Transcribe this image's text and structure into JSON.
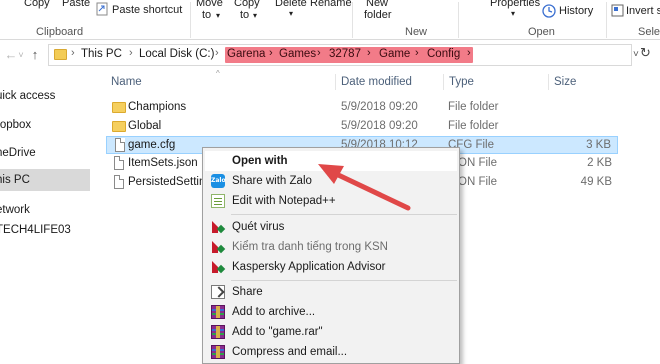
{
  "ribbon": {
    "copy_label": "Copy",
    "paste_label": "Paste",
    "paste_shortcut_label": "Paste shortcut",
    "move_to_label": "Move",
    "move_to_label2": "to",
    "copy_to_label": "Copy",
    "copy_to_label2": "to",
    "delete_label": "Delete",
    "rename_label": "Rename",
    "new_folder_label": "New",
    "new_folder_label2": "folder",
    "properties_label": "Properties",
    "history_label": "History",
    "invert_label": "Invert s",
    "groups": {
      "clipboard": "Clipboard",
      "new": "New",
      "open": "Open",
      "select": "Selec"
    }
  },
  "address": {
    "crumbs": [
      "This PC",
      "Local Disk (C:)",
      "Garena",
      "Games",
      "32787",
      "Game",
      "Config"
    ],
    "highlight_color": "#f27b88"
  },
  "navpane": {
    "items": [
      "uick access",
      "ropbox",
      "neDrive",
      "his PC",
      "etwork",
      "TECH4LIFE03"
    ],
    "selected": "his PC"
  },
  "list": {
    "headers": {
      "name": "Name",
      "date": "Date modified",
      "type": "Type",
      "size": "Size"
    },
    "rows": [
      {
        "icon": "folder-icon",
        "name": "Champions",
        "date": "5/9/2018 09:20",
        "type": "File folder",
        "size": ""
      },
      {
        "icon": "folder-icon",
        "name": "Global",
        "date": "5/9/2018 09:20",
        "type": "File folder",
        "size": ""
      },
      {
        "icon": "file-icon",
        "name": "game.cfg",
        "date": "5/9/2018 10:12",
        "type": "CFG File",
        "size": "3 KB"
      },
      {
        "icon": "file-icon",
        "name": "ItemSets.json",
        "date": "",
        "type": "ON File",
        "size": "2 KB"
      },
      {
        "icon": "file-icon",
        "name": "PersistedSetting",
        "date": "",
        "type": "ON File",
        "size": "49 KB"
      }
    ],
    "selected_row": "game.cfg"
  },
  "context_menu": {
    "items": [
      {
        "label": "Open with",
        "icon": "",
        "bold": true
      },
      {
        "label": "Share with Zalo",
        "icon": "zalo-icon"
      },
      {
        "label": "Edit with Notepad++",
        "icon": "notepadpp-icon"
      },
      {
        "label": "Quét virus",
        "icon": "kaspersky-icon"
      },
      {
        "label": "Kiểm tra danh tiếng trong KSN",
        "icon": "kaspersky-icon",
        "greyed": true
      },
      {
        "label": "Kaspersky Application Advisor",
        "icon": "kaspersky-icon"
      },
      {
        "label": "Share",
        "icon": "share-icon"
      },
      {
        "label": "Add to archive...",
        "icon": "winrar-icon"
      },
      {
        "label": "Add to \"game.rar\"",
        "icon": "winrar-icon"
      },
      {
        "label": "Compress and email...",
        "icon": "winrar-icon"
      }
    ]
  },
  "colors": {
    "selection_bg": "#cce8ff",
    "arrow": "#e04848",
    "header_text": "#4c607a"
  }
}
